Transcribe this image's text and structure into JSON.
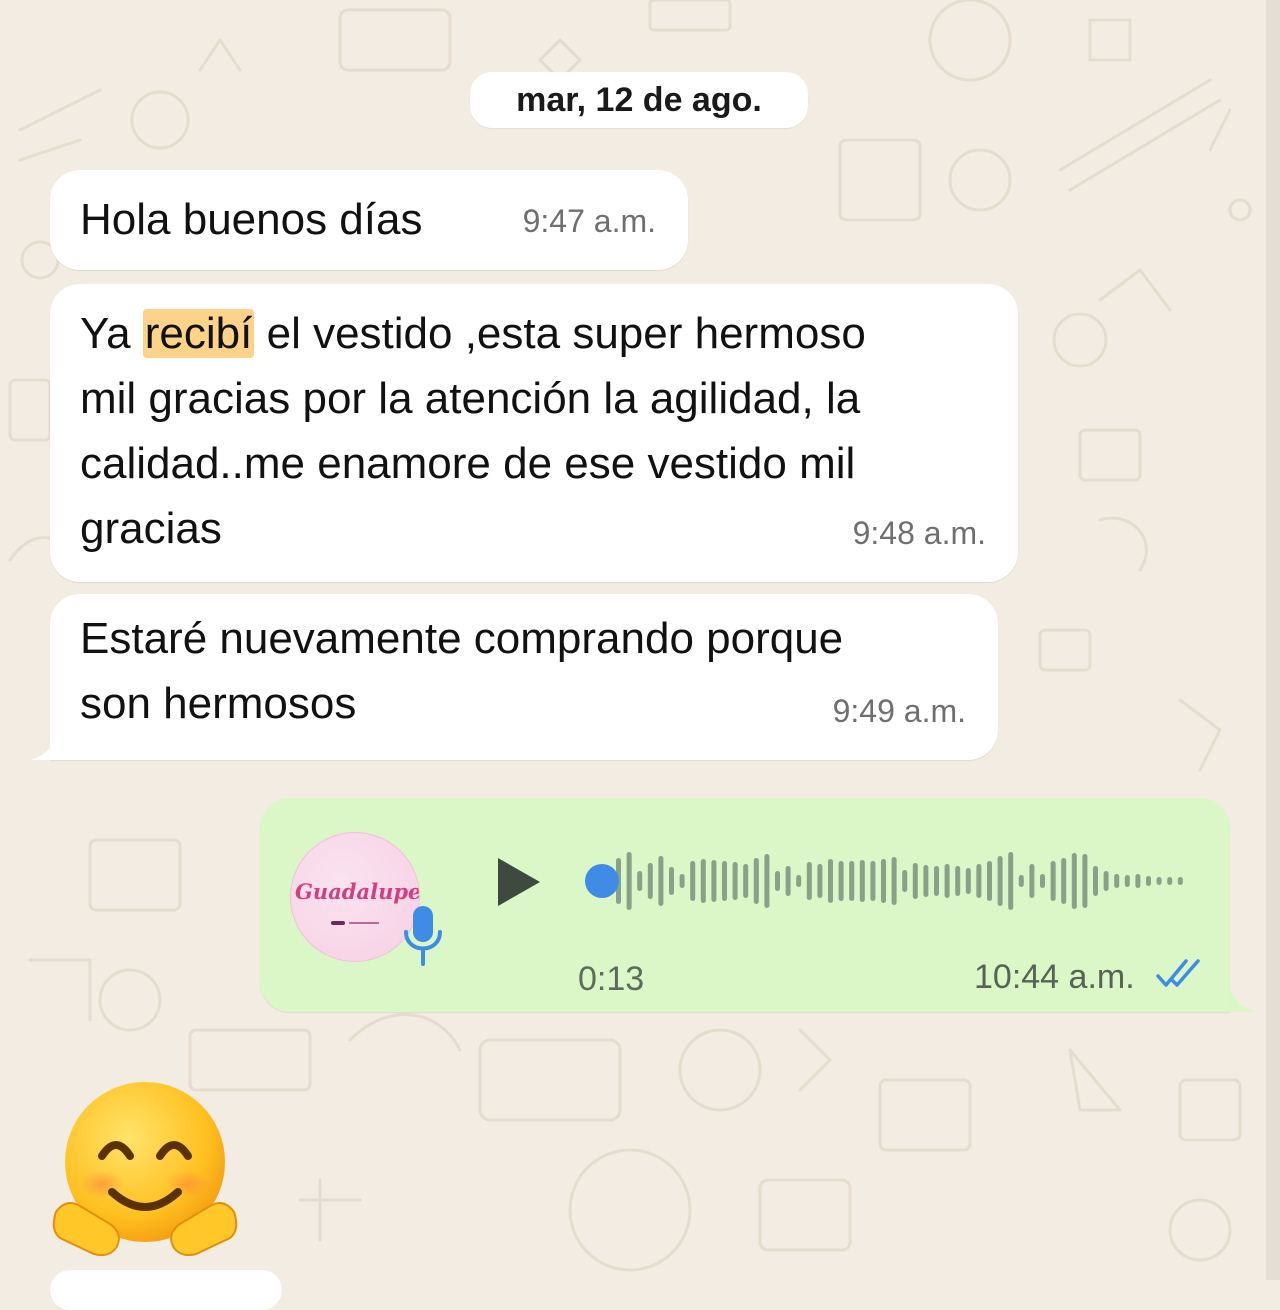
{
  "date_separator": "mar, 12 de ago.",
  "messages": [
    {
      "direction": "incoming",
      "lines": [
        "Hola buenos días"
      ],
      "time": "9:47 a.m."
    },
    {
      "direction": "incoming",
      "highlight_word": "recibí",
      "line1_pre": "Ya ",
      "line1_post": " el vestido ,esta super hermoso",
      "lines": [
        "mil gracias por la atención la agilidad,  la",
        "calidad..me enamore de ese vestido mil",
        "gracias"
      ],
      "time": "9:48 a.m."
    },
    {
      "direction": "incoming",
      "lines": [
        "Estaré nuevamente comprando porque",
        "son hermosos"
      ],
      "time": "9:49 a.m."
    }
  ],
  "voice_message": {
    "direction": "outgoing",
    "avatar_logo_text": "Guadalupe",
    "duration": "0:13",
    "time": "10:44 a.m.",
    "status": "read",
    "playback_progress": 0
  },
  "sticker": {
    "emoji": "hugging-face"
  },
  "colors": {
    "chat_background": "#f2ece2",
    "incoming_bubble": "#ffffff",
    "outgoing_bubble": "#dbf6c7",
    "highlight": "#fcd388",
    "read_ticks": "#3e8ce6",
    "waveform": "#8aa08a",
    "play_head": "#3e8ce6"
  }
}
